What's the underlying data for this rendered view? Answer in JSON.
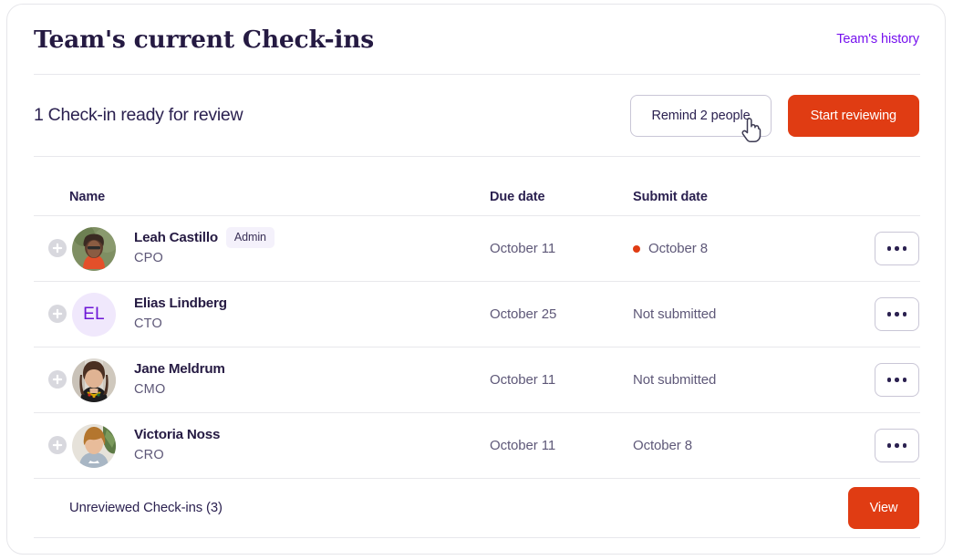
{
  "header": {
    "title": "Team's current Check-ins",
    "history_link": "Team's history"
  },
  "subheader": {
    "review_count_text": "1 Check-in ready for review",
    "remind_button": "Remind 2 people",
    "start_review_button": "Start reviewing"
  },
  "table": {
    "columns": {
      "name": "Name",
      "due_date": "Due date",
      "submit_date": "Submit date"
    },
    "rows": [
      {
        "name": "Leah Castillo",
        "badge": "Admin",
        "role": "CPO",
        "due_date": "October 11",
        "submit_date": "October 8",
        "has_status_dot": true,
        "avatar_type": "photo",
        "initials": ""
      },
      {
        "name": "Elias Lindberg",
        "badge": "",
        "role": "CTO",
        "due_date": "October 25",
        "submit_date": "Not submitted",
        "has_status_dot": false,
        "avatar_type": "initials",
        "initials": "EL"
      },
      {
        "name": "Jane Meldrum",
        "badge": "",
        "role": "CMO",
        "due_date": "October 11",
        "submit_date": "Not submitted",
        "has_status_dot": false,
        "avatar_type": "photo",
        "initials": ""
      },
      {
        "name": "Victoria Noss",
        "badge": "",
        "role": "CRO",
        "due_date": "October 11",
        "submit_date": "October 8",
        "has_status_dot": false,
        "avatar_type": "photo",
        "initials": ""
      }
    ]
  },
  "footer": {
    "label": "Unreviewed Check-ins (3)",
    "view_button": "View"
  },
  "colors": {
    "accent_orange": "#e03c13",
    "link_purple": "#7611ee",
    "text_navy": "#251a42",
    "text_muted": "#5e5878",
    "badge_bg": "#f4f1fb",
    "avatar_bg": "#f0e8fc",
    "status_dot": "#e03c13",
    "border": "#e6e6ea"
  },
  "icons": {
    "expand": "plus-circle-icon",
    "kebab": "more-options-icon",
    "cursor": "pointer-hand-cursor"
  }
}
